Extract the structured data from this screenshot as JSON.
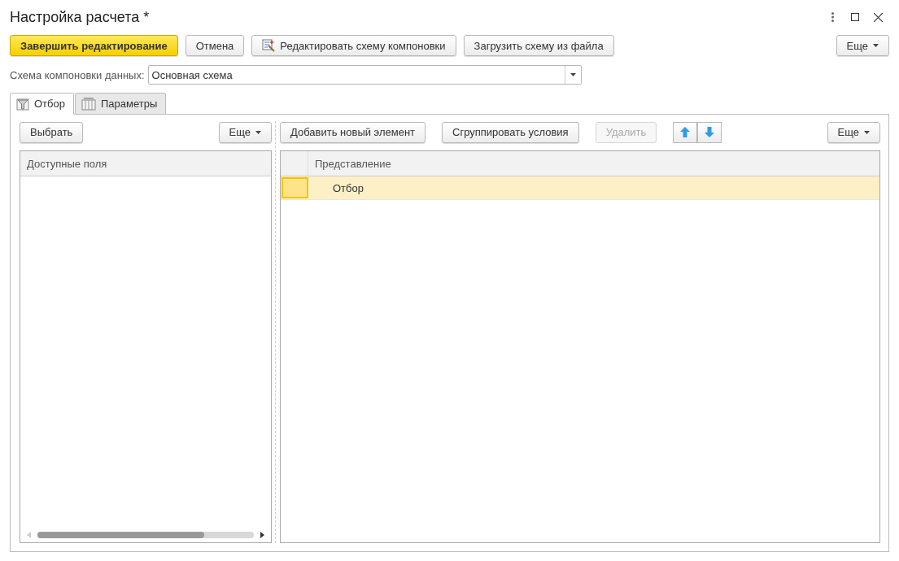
{
  "window": {
    "title": "Настройка расчета *"
  },
  "toolbar": {
    "buttons": [
      {
        "label": "Завершить редактирование",
        "kind": "primary"
      },
      {
        "label": "Отмена",
        "kind": "plain"
      },
      {
        "label": "Редактировать схему компоновки",
        "kind": "icon"
      },
      {
        "label": "Загрузить схему из файла",
        "kind": "plain"
      }
    ],
    "more": "Еще"
  },
  "scheme": {
    "label": "Схема компоновки данных:",
    "value": "Основная схема"
  },
  "tabs": [
    {
      "label": "Отбор",
      "selected": true
    },
    {
      "label": "Параметры",
      "selected": false
    }
  ],
  "left": {
    "select_button": "Выбрать",
    "more": "Еще",
    "column": "Доступные поля"
  },
  "right": {
    "buttons": [
      {
        "label": "Добавить новый элемент",
        "disabled": false
      },
      {
        "label": "Сгруппировать условия",
        "disabled": false
      },
      {
        "label": "Удалить",
        "disabled": true
      }
    ],
    "more": "Еще",
    "column": "Представление",
    "rows": [
      {
        "label": "Отбор",
        "selected": true
      }
    ]
  }
}
